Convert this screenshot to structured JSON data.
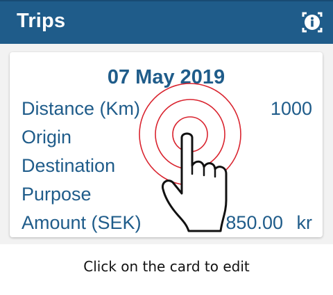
{
  "header": {
    "title": "Trips",
    "info_icon": "info-icon"
  },
  "card": {
    "date": "07 May 2019",
    "fields": {
      "distance_label": "Distance (Km)",
      "distance_value": "1000",
      "origin_label": "Origin",
      "destination_label": "Destination",
      "purpose_label": "Purpose",
      "amount_label": "Amount (SEK)",
      "amount_value": "850.00",
      "amount_currency": "kr"
    }
  },
  "overlay": {
    "icon": "tap-hand-icon",
    "ring_color": "#d9232e"
  },
  "hint": "Click on the card to edit",
  "colors": {
    "primary": "#1f5c8a",
    "background": "#f2f2f2",
    "card": "#ffffff"
  }
}
